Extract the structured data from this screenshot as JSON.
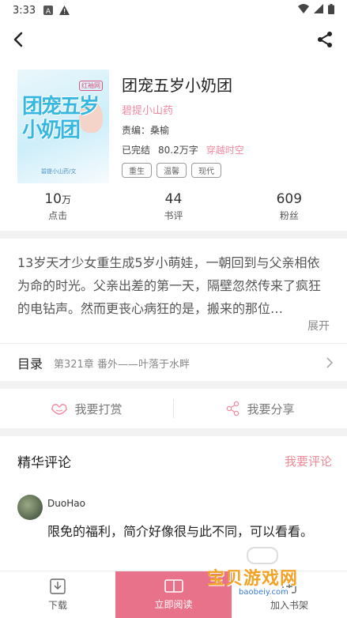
{
  "status_bar": {
    "time": "3:33"
  },
  "book": {
    "title": "团宠五岁小奶团",
    "author": "碧提小山药",
    "editor": "责编：桑榆",
    "status": "已完结",
    "word_count": "80.2万字",
    "category": "穿越时空",
    "tags": [
      "重生",
      "温馨",
      "现代"
    ],
    "cover": {
      "site": "红袖网",
      "title": "团宠五岁小奶团",
      "author": "碧提小山药/文"
    }
  },
  "stats": [
    {
      "value": "10",
      "unit": "万",
      "label": "点击"
    },
    {
      "value": "44",
      "unit": "",
      "label": "书评"
    },
    {
      "value": "609",
      "unit": "",
      "label": "粉丝"
    }
  ],
  "description": {
    "text": "13岁天才少女重生成5岁小萌娃，一朝回到与父亲相依为命的时光。父亲出差的第一天，隔壁忽然传来了疯狂的电钻声。然而更丧心病狂的是，搬来的那位…",
    "expand_label": "展开"
  },
  "toc": {
    "label": "目录",
    "latest_chapter": "第321章 番外——叶落于水畔"
  },
  "actions": {
    "reward": "我要打赏",
    "share": "我要分享"
  },
  "comments": {
    "heading": "精华评论",
    "write_label": "我要评论",
    "items": [
      {
        "user": "DuoHao",
        "text": "限免的福利，简介好像很与此不同，可以看看。"
      }
    ]
  },
  "bottom_bar": {
    "download": "下载",
    "read": "立即阅读",
    "shelf": "加入书架"
  },
  "watermark": {
    "text": "宝贝游戏网",
    "url": "baobeiy.com"
  },
  "colors": {
    "accent": "#e8728a",
    "author_pink": "#f08aa0",
    "comment_pink": "#ee8b95"
  }
}
